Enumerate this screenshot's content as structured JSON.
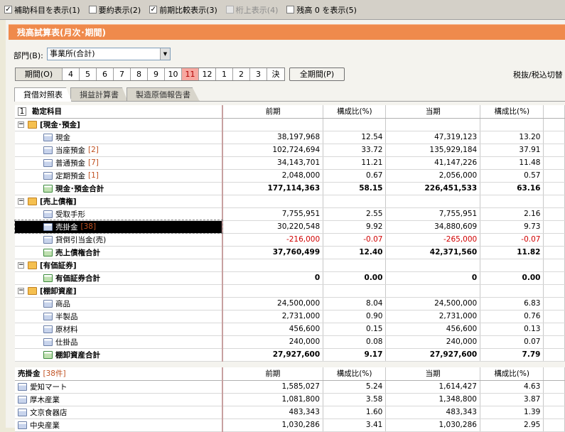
{
  "options": [
    {
      "label": "補助科目を表示(1)",
      "checked": true,
      "disabled": false
    },
    {
      "label": "要約表示(2)",
      "checked": false,
      "disabled": false
    },
    {
      "label": "前期比較表示(3)",
      "checked": true,
      "disabled": false
    },
    {
      "label": "桁上表示(4)",
      "checked": false,
      "disabled": true
    },
    {
      "label": "残高 0 を表示(5)",
      "checked": false,
      "disabled": false
    }
  ],
  "title": "残高試算表(月次･期間)",
  "department": {
    "label": "部門(B):",
    "value": "事業所(合計)"
  },
  "period_label": "期間(O)",
  "periods": [
    "4",
    "5",
    "6",
    "7",
    "8",
    "9",
    "10",
    "11",
    "12",
    "1",
    "2",
    "3",
    "決"
  ],
  "selected_period": "11",
  "full_period_button": "全期間(P)",
  "tax_label": "税抜/税込切替",
  "tabs": [
    "貸借対照表",
    "損益計算書",
    "製造原価報告書"
  ],
  "active_tab": 0,
  "main_table": {
    "headers": {
      "index": "1",
      "name": "勘定科目",
      "prev": "前期",
      "ratio1": "構成比(%)",
      "curr": "当期",
      "ratio2": "構成比(%)"
    },
    "rows": [
      {
        "type": "group",
        "name": "[現金･預金]"
      },
      {
        "type": "item",
        "name": "現金",
        "count": "",
        "prev": "38,197,968",
        "r1": "12.54",
        "curr": "47,319,123",
        "r2": "13.20"
      },
      {
        "type": "item",
        "name": "当座預金",
        "count": "[2]",
        "prev": "102,724,694",
        "r1": "33.72",
        "curr": "135,929,184",
        "r2": "37.91"
      },
      {
        "type": "item",
        "name": "普通預金",
        "count": "[7]",
        "prev": "34,143,701",
        "r1": "11.21",
        "curr": "41,147,226",
        "r2": "11.48"
      },
      {
        "type": "item",
        "name": "定期預金",
        "count": "[1]",
        "prev": "2,048,000",
        "r1": "0.67",
        "curr": "2,056,000",
        "r2": "0.57"
      },
      {
        "type": "total",
        "name": "現金･預金合計",
        "count": "",
        "prev": "177,114,363",
        "r1": "58.15",
        "curr": "226,451,533",
        "r2": "63.16"
      },
      {
        "type": "group",
        "name": "[売上債権]"
      },
      {
        "type": "item",
        "name": "受取手形",
        "count": "",
        "prev": "7,755,951",
        "r1": "2.55",
        "curr": "7,755,951",
        "r2": "2.16"
      },
      {
        "type": "item",
        "name": "売掛金",
        "count": "[38]",
        "prev": "30,220,548",
        "r1": "9.92",
        "curr": "34,880,609",
        "r2": "9.73",
        "selected": true
      },
      {
        "type": "item",
        "name": "貸倒引当金(売)",
        "count": "",
        "prev": "-216,000",
        "r1": "-0.07",
        "curr": "-265,000",
        "r2": "-0.07",
        "negative": true
      },
      {
        "type": "total",
        "name": "売上債権合計",
        "count": "",
        "prev": "37,760,499",
        "r1": "12.40",
        "curr": "42,371,560",
        "r2": "11.82"
      },
      {
        "type": "group",
        "name": "[有価証券]"
      },
      {
        "type": "total",
        "name": "有価証券合計",
        "count": "",
        "prev": "0",
        "r1": "0.00",
        "curr": "0",
        "r2": "0.00"
      },
      {
        "type": "group",
        "name": "[棚卸資産]"
      },
      {
        "type": "item",
        "name": "商品",
        "count": "",
        "prev": "24,500,000",
        "r1": "8.04",
        "curr": "24,500,000",
        "r2": "6.83"
      },
      {
        "type": "item",
        "name": "半製品",
        "count": "",
        "prev": "2,731,000",
        "r1": "0.90",
        "curr": "2,731,000",
        "r2": "0.76"
      },
      {
        "type": "item",
        "name": "原材料",
        "count": "",
        "prev": "456,600",
        "r1": "0.15",
        "curr": "456,600",
        "r2": "0.13"
      },
      {
        "type": "item",
        "name": "仕掛品",
        "count": "",
        "prev": "240,000",
        "r1": "0.08",
        "curr": "240,000",
        "r2": "0.07"
      },
      {
        "type": "total",
        "name": "棚卸資産合計",
        "count": "",
        "prev": "27,927,600",
        "r1": "9.17",
        "curr": "27,927,600",
        "r2": "7.79"
      }
    ]
  },
  "sub_table": {
    "headers": {
      "name": "売掛金",
      "count": "[38件]",
      "prev": "前期",
      "ratio1": "構成比(%)",
      "curr": "当期",
      "ratio2": "構成比(%)"
    },
    "rows": [
      {
        "name": "愛知マート",
        "prev": "1,585,027",
        "r1": "5.24",
        "curr": "1,614,427",
        "r2": "4.63"
      },
      {
        "name": "厚木産業",
        "prev": "1,081,800",
        "r1": "3.58",
        "curr": "1,348,800",
        "r2": "3.87"
      },
      {
        "name": "文京食器店",
        "prev": "483,343",
        "r1": "1.60",
        "curr": "483,343",
        "r2": "1.39"
      },
      {
        "name": "中央産業",
        "prev": "1,030,286",
        "r1": "3.41",
        "curr": "1,030,286",
        "r2": "2.95"
      }
    ]
  }
}
